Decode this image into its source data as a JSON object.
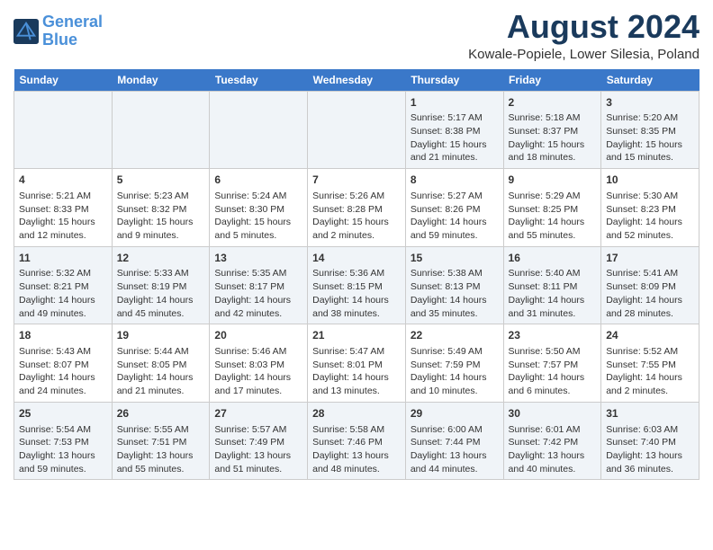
{
  "header": {
    "logo_line1": "General",
    "logo_line2": "Blue",
    "title": "August 2024",
    "subtitle": "Kowale-Popiele, Lower Silesia, Poland"
  },
  "days_of_week": [
    "Sunday",
    "Monday",
    "Tuesday",
    "Wednesday",
    "Thursday",
    "Friday",
    "Saturday"
  ],
  "weeks": [
    [
      {
        "day": "",
        "content": ""
      },
      {
        "day": "",
        "content": ""
      },
      {
        "day": "",
        "content": ""
      },
      {
        "day": "",
        "content": ""
      },
      {
        "day": "1",
        "content": "Sunrise: 5:17 AM\nSunset: 8:38 PM\nDaylight: 15 hours\nand 21 minutes."
      },
      {
        "day": "2",
        "content": "Sunrise: 5:18 AM\nSunset: 8:37 PM\nDaylight: 15 hours\nand 18 minutes."
      },
      {
        "day": "3",
        "content": "Sunrise: 5:20 AM\nSunset: 8:35 PM\nDaylight: 15 hours\nand 15 minutes."
      }
    ],
    [
      {
        "day": "4",
        "content": "Sunrise: 5:21 AM\nSunset: 8:33 PM\nDaylight: 15 hours\nand 12 minutes."
      },
      {
        "day": "5",
        "content": "Sunrise: 5:23 AM\nSunset: 8:32 PM\nDaylight: 15 hours\nand 9 minutes."
      },
      {
        "day": "6",
        "content": "Sunrise: 5:24 AM\nSunset: 8:30 PM\nDaylight: 15 hours\nand 5 minutes."
      },
      {
        "day": "7",
        "content": "Sunrise: 5:26 AM\nSunset: 8:28 PM\nDaylight: 15 hours\nand 2 minutes."
      },
      {
        "day": "8",
        "content": "Sunrise: 5:27 AM\nSunset: 8:26 PM\nDaylight: 14 hours\nand 59 minutes."
      },
      {
        "day": "9",
        "content": "Sunrise: 5:29 AM\nSunset: 8:25 PM\nDaylight: 14 hours\nand 55 minutes."
      },
      {
        "day": "10",
        "content": "Sunrise: 5:30 AM\nSunset: 8:23 PM\nDaylight: 14 hours\nand 52 minutes."
      }
    ],
    [
      {
        "day": "11",
        "content": "Sunrise: 5:32 AM\nSunset: 8:21 PM\nDaylight: 14 hours\nand 49 minutes."
      },
      {
        "day": "12",
        "content": "Sunrise: 5:33 AM\nSunset: 8:19 PM\nDaylight: 14 hours\nand 45 minutes."
      },
      {
        "day": "13",
        "content": "Sunrise: 5:35 AM\nSunset: 8:17 PM\nDaylight: 14 hours\nand 42 minutes."
      },
      {
        "day": "14",
        "content": "Sunrise: 5:36 AM\nSunset: 8:15 PM\nDaylight: 14 hours\nand 38 minutes."
      },
      {
        "day": "15",
        "content": "Sunrise: 5:38 AM\nSunset: 8:13 PM\nDaylight: 14 hours\nand 35 minutes."
      },
      {
        "day": "16",
        "content": "Sunrise: 5:40 AM\nSunset: 8:11 PM\nDaylight: 14 hours\nand 31 minutes."
      },
      {
        "day": "17",
        "content": "Sunrise: 5:41 AM\nSunset: 8:09 PM\nDaylight: 14 hours\nand 28 minutes."
      }
    ],
    [
      {
        "day": "18",
        "content": "Sunrise: 5:43 AM\nSunset: 8:07 PM\nDaylight: 14 hours\nand 24 minutes."
      },
      {
        "day": "19",
        "content": "Sunrise: 5:44 AM\nSunset: 8:05 PM\nDaylight: 14 hours\nand 21 minutes."
      },
      {
        "day": "20",
        "content": "Sunrise: 5:46 AM\nSunset: 8:03 PM\nDaylight: 14 hours\nand 17 minutes."
      },
      {
        "day": "21",
        "content": "Sunrise: 5:47 AM\nSunset: 8:01 PM\nDaylight: 14 hours\nand 13 minutes."
      },
      {
        "day": "22",
        "content": "Sunrise: 5:49 AM\nSunset: 7:59 PM\nDaylight: 14 hours\nand 10 minutes."
      },
      {
        "day": "23",
        "content": "Sunrise: 5:50 AM\nSunset: 7:57 PM\nDaylight: 14 hours\nand 6 minutes."
      },
      {
        "day": "24",
        "content": "Sunrise: 5:52 AM\nSunset: 7:55 PM\nDaylight: 14 hours\nand 2 minutes."
      }
    ],
    [
      {
        "day": "25",
        "content": "Sunrise: 5:54 AM\nSunset: 7:53 PM\nDaylight: 13 hours\nand 59 minutes."
      },
      {
        "day": "26",
        "content": "Sunrise: 5:55 AM\nSunset: 7:51 PM\nDaylight: 13 hours\nand 55 minutes."
      },
      {
        "day": "27",
        "content": "Sunrise: 5:57 AM\nSunset: 7:49 PM\nDaylight: 13 hours\nand 51 minutes."
      },
      {
        "day": "28",
        "content": "Sunrise: 5:58 AM\nSunset: 7:46 PM\nDaylight: 13 hours\nand 48 minutes."
      },
      {
        "day": "29",
        "content": "Sunrise: 6:00 AM\nSunset: 7:44 PM\nDaylight: 13 hours\nand 44 minutes."
      },
      {
        "day": "30",
        "content": "Sunrise: 6:01 AM\nSunset: 7:42 PM\nDaylight: 13 hours\nand 40 minutes."
      },
      {
        "day": "31",
        "content": "Sunrise: 6:03 AM\nSunset: 7:40 PM\nDaylight: 13 hours\nand 36 minutes."
      }
    ]
  ]
}
